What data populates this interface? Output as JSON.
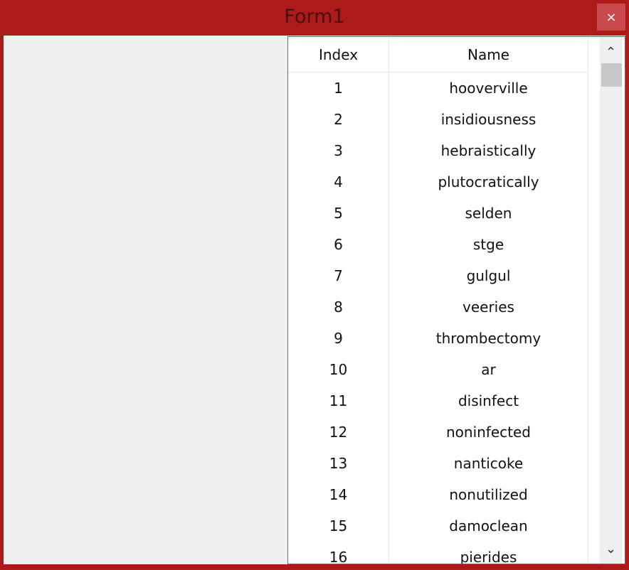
{
  "window": {
    "title": "Form1",
    "close_glyph": "×"
  },
  "grid": {
    "columns": [
      "Index",
      "Name"
    ],
    "rows": [
      {
        "index": "1",
        "name": "hooverville"
      },
      {
        "index": "2",
        "name": "insidiousness"
      },
      {
        "index": "3",
        "name": "hebraistically"
      },
      {
        "index": "4",
        "name": "plutocratically"
      },
      {
        "index": "5",
        "name": "selden"
      },
      {
        "index": "6",
        "name": "stge"
      },
      {
        "index": "7",
        "name": "gulgul"
      },
      {
        "index": "8",
        "name": "veeries"
      },
      {
        "index": "9",
        "name": "thrombectomy"
      },
      {
        "index": "10",
        "name": "ar"
      },
      {
        "index": "11",
        "name": "disinfect"
      },
      {
        "index": "12",
        "name": "noninfected"
      },
      {
        "index": "13",
        "name": "nanticoke"
      },
      {
        "index": "14",
        "name": "nonutilized"
      },
      {
        "index": "15",
        "name": "damoclean"
      },
      {
        "index": "16",
        "name": "pierides"
      }
    ]
  },
  "scrollbar": {
    "up_glyph": "⌃",
    "down_glyph": "⌄"
  },
  "colors": {
    "titlebar": "#ad1a1a",
    "client": "#f0f0f0",
    "close_button": "#c94a4a"
  }
}
